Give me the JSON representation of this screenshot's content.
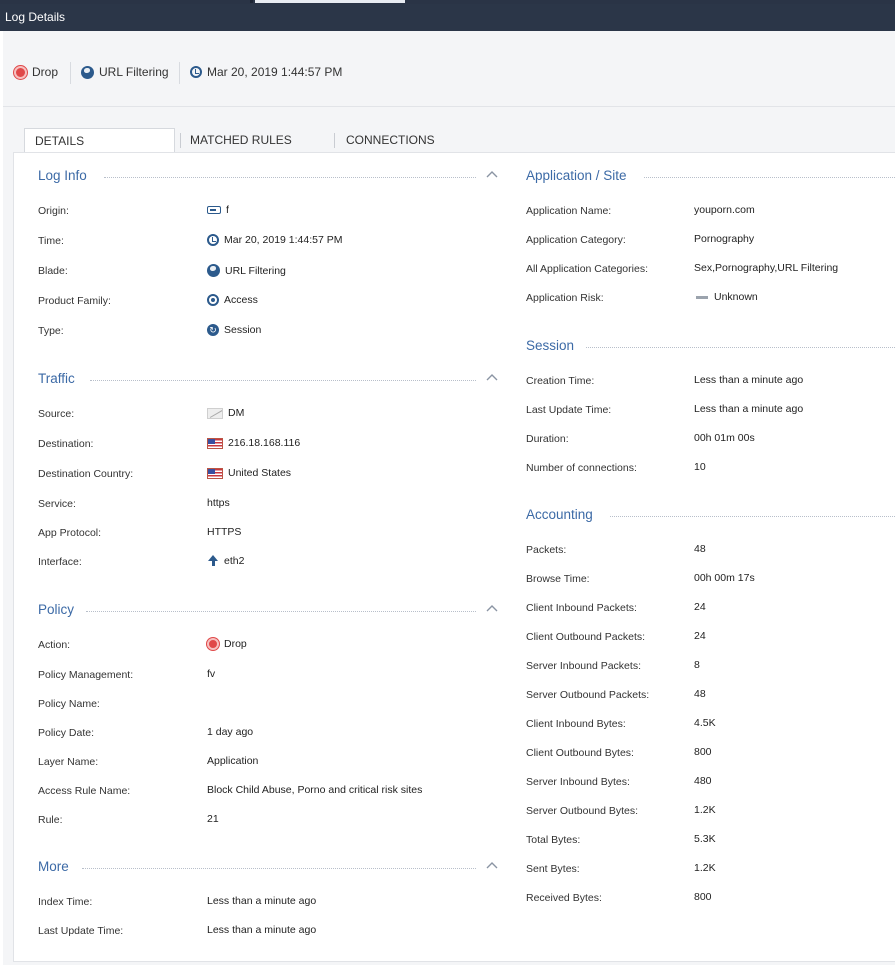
{
  "window": {
    "title": "Log Details"
  },
  "header": {
    "action": "Drop",
    "blade": "URL Filtering",
    "time": "Mar 20, 2019 1:44:57 PM"
  },
  "tabs": [
    "DETAILS",
    "MATCHED RULES",
    "CONNECTIONS"
  ],
  "log_info": {
    "title": "Log Info",
    "rows": [
      {
        "label": "Origin:",
        "value": "f",
        "icon": "gateway-icon"
      },
      {
        "label": "Time:",
        "value": "Mar 20, 2019 1:44:57 PM",
        "icon": "clock-icon"
      },
      {
        "label": "Blade:",
        "value": "URL Filtering",
        "icon": "globe-icon"
      },
      {
        "label": "Product Family:",
        "value": "Access",
        "icon": "access-icon"
      },
      {
        "label": "Type:",
        "value": "Session",
        "icon": "session-icon"
      }
    ]
  },
  "traffic": {
    "title": "Traffic",
    "rows": [
      {
        "label": "Source:",
        "value": "DM",
        "icon": "host-icon"
      },
      {
        "label": "Destination:",
        "value": "216.18.168.116",
        "icon": "us-flag-icon"
      },
      {
        "label": "Destination Country:",
        "value": "United States",
        "icon": "us-flag-icon"
      },
      {
        "label": "Service:",
        "value": "https"
      },
      {
        "label": "App Protocol:",
        "value": "HTTPS"
      },
      {
        "label": "Interface:",
        "value": "eth2",
        "icon": "outbound-arrow-icon"
      }
    ]
  },
  "policy": {
    "title": "Policy",
    "rows": [
      {
        "label": "Action:",
        "value": "Drop",
        "icon": "drop-icon"
      },
      {
        "label": "Policy Management:",
        "value": "fv"
      },
      {
        "label": "Policy Name:",
        "value": ""
      },
      {
        "label": "Policy Date:",
        "value": "1 day ago"
      },
      {
        "label": "Layer Name:",
        "value": "Application"
      },
      {
        "label": "Access Rule Name:",
        "value": "Block Child Abuse, Porno and critical risk sites"
      },
      {
        "label": "Rule:",
        "value": "21"
      }
    ]
  },
  "more": {
    "title": "More",
    "rows": [
      {
        "label": "Index Time:",
        "value": "Less than a minute ago"
      },
      {
        "label": "Last Update Time:",
        "value": "Less than a minute ago"
      }
    ]
  },
  "application": {
    "title": "Application / Site",
    "rows": [
      {
        "label": "Application Name:",
        "value": "youporn.com"
      },
      {
        "label": "Application Category:",
        "value": "Pornography"
      },
      {
        "label": "All Application Categories:",
        "value": "Sex,Pornography,URL Filtering"
      },
      {
        "label": "Application Risk:",
        "value": "Unknown",
        "icon": "risk-icon"
      }
    ]
  },
  "session": {
    "title": "Session",
    "rows": [
      {
        "label": "Creation Time:",
        "value": "Less than a minute ago"
      },
      {
        "label": "Last Update Time:",
        "value": "Less than a minute ago"
      },
      {
        "label": "Duration:",
        "value": "00h 01m 00s"
      },
      {
        "label": "Number of connections:",
        "value": "10"
      }
    ]
  },
  "accounting": {
    "title": "Accounting",
    "rows": [
      {
        "label": "Packets:",
        "value": "48"
      },
      {
        "label": "Browse Time:",
        "value": "00h 00m 17s"
      },
      {
        "label": "Client Inbound Packets:",
        "value": "24"
      },
      {
        "label": "Client Outbound Packets:",
        "value": "24"
      },
      {
        "label": "Server Inbound Packets:",
        "value": "8"
      },
      {
        "label": "Server Outbound Packets:",
        "value": "48"
      },
      {
        "label": "Client Inbound Bytes:",
        "value": "4.5K"
      },
      {
        "label": "Client Outbound Bytes:",
        "value": "800"
      },
      {
        "label": "Server Inbound Bytes:",
        "value": "480"
      },
      {
        "label": "Server Outbound Bytes:",
        "value": "1.2K"
      },
      {
        "label": "Total Bytes:",
        "value": "5.3K"
      },
      {
        "label": "Sent Bytes:",
        "value": "1.2K"
      },
      {
        "label": "Received Bytes:",
        "value": "800"
      }
    ]
  },
  "colors": {
    "titlebar": "#2b3648",
    "section_title": "#3c6aa6",
    "drop_red": "#e04848",
    "icon_blue": "#2c5a8c"
  }
}
